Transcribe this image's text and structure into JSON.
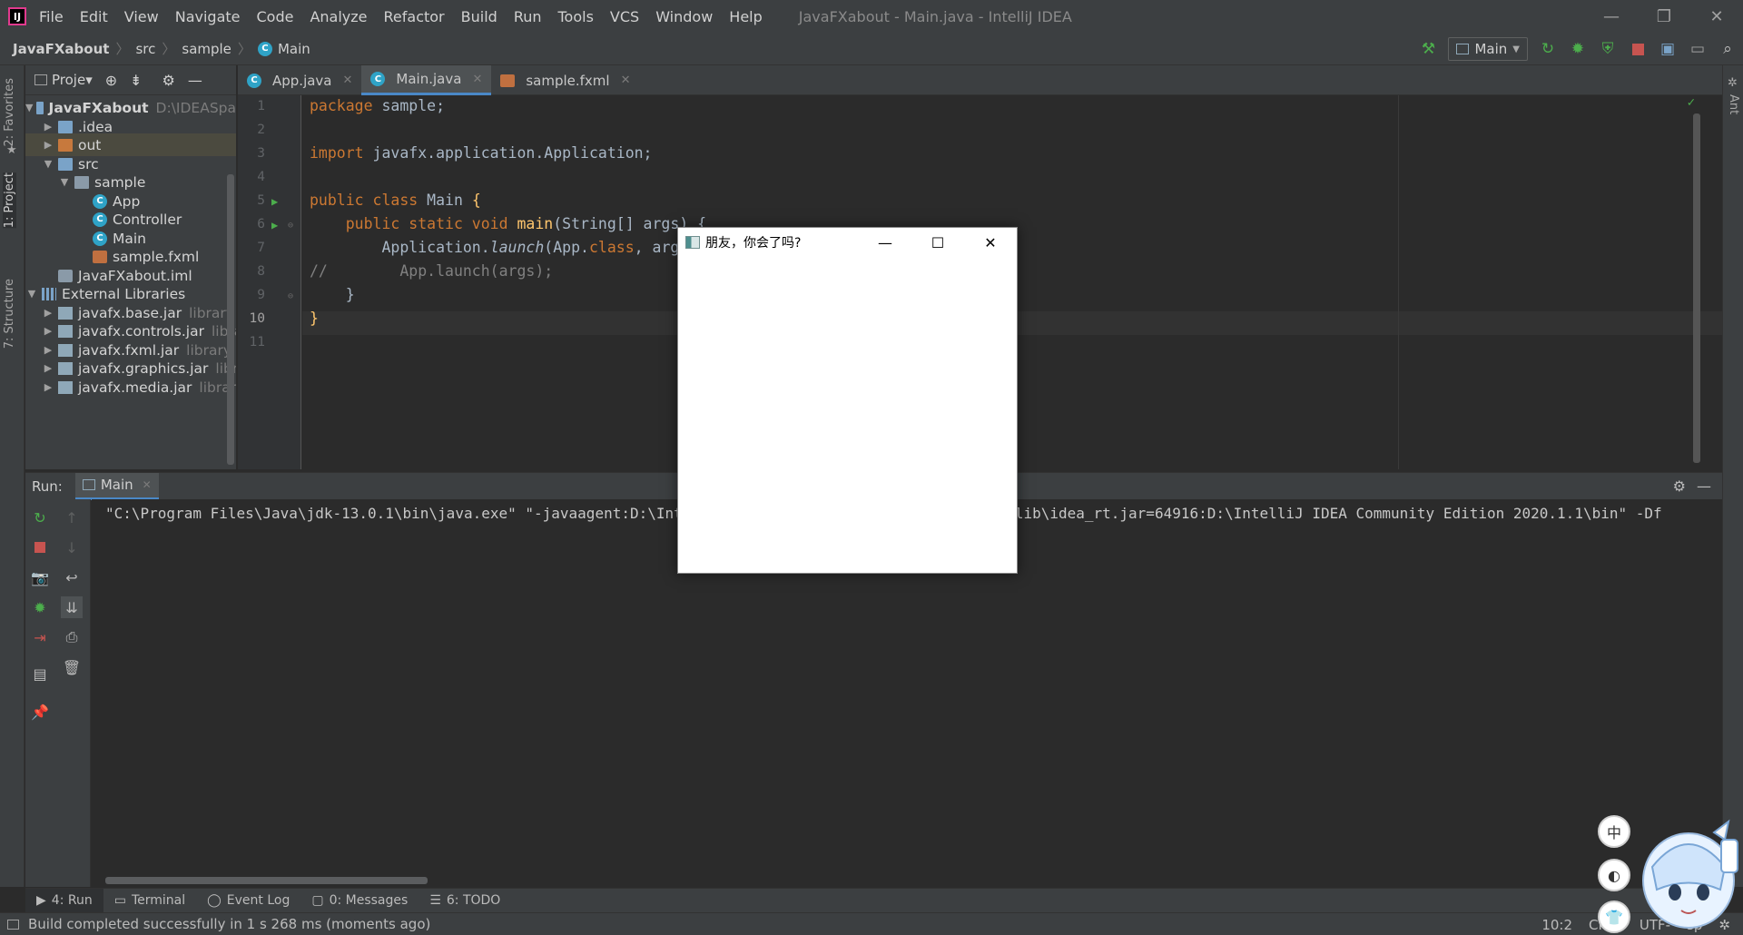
{
  "app": {
    "logo_text": "IJ",
    "menu": [
      "File",
      "Edit",
      "View",
      "Navigate",
      "Code",
      "Analyze",
      "Refactor",
      "Build",
      "Run",
      "Tools",
      "VCS",
      "Window",
      "Help"
    ],
    "window_title": "JavaFXabout - Main.java - IntelliJ IDEA",
    "window_controls": {
      "minimize": "—",
      "restore": "❐",
      "close": "✕"
    }
  },
  "navbar": {
    "breadcrumbs": [
      "JavaFXabout",
      "src",
      "sample",
      "Main"
    ],
    "run_config": "Main"
  },
  "left_stripe": {
    "favorites": "2: Favorites",
    "project": "1: Project",
    "structure": "7: Structure"
  },
  "right_stripe": {
    "ant": "Ant"
  },
  "project_panel": {
    "title": "Proje▾",
    "tree": [
      {
        "label": "JavaFXabout",
        "hint": "D:\\IDEASpa",
        "type": "module",
        "arrow": "▼"
      },
      {
        "label": ".idea",
        "type": "folder",
        "arrow": "▶"
      },
      {
        "label": "out",
        "type": "folder-out",
        "arrow": "▶"
      },
      {
        "label": "src",
        "type": "folder",
        "arrow": "▼"
      },
      {
        "label": "sample",
        "type": "package",
        "arrow": "▼"
      },
      {
        "label": "App",
        "type": "class"
      },
      {
        "label": "Controller",
        "type": "class"
      },
      {
        "label": "Main",
        "type": "class"
      },
      {
        "label": "sample.fxml",
        "type": "fxml"
      },
      {
        "label": "JavaFXabout.iml",
        "type": "iml"
      },
      {
        "label": "External Libraries",
        "type": "libs",
        "arrow": "▼"
      },
      {
        "label": "javafx.base.jar",
        "hint": "library r",
        "type": "jar",
        "arrow": "▶"
      },
      {
        "label": "javafx.controls.jar",
        "hint": "libra",
        "type": "jar",
        "arrow": "▶"
      },
      {
        "label": "javafx.fxml.jar",
        "hint": "library r",
        "type": "jar",
        "arrow": "▶"
      },
      {
        "label": "javafx.graphics.jar",
        "hint": "libr",
        "type": "jar",
        "arrow": "▶"
      },
      {
        "label": "javafx.media.jar",
        "hint": "library",
        "type": "jar",
        "arrow": "▶"
      }
    ]
  },
  "editor": {
    "tabs": [
      {
        "label": "App.java",
        "active": false
      },
      {
        "label": "Main.java",
        "active": true
      },
      {
        "label": "sample.fxml",
        "active": false
      }
    ],
    "line_numbers": [
      "1",
      "2",
      "3",
      "4",
      "5",
      "6",
      "7",
      "8",
      "9",
      "10",
      "11"
    ],
    "code": {
      "l1_kw": "package",
      "l1_rest": " sample;",
      "l3_kw": "import",
      "l3_rest": " javafx.application.Application;",
      "l5_kw": "public class",
      "l5_name": " Main ",
      "l5_brace": "{",
      "l6_kw": "    public static void",
      "l6_fn": " main",
      "l6_rest": "(String[] args) {",
      "l7_pre": "        Application.",
      "l7_it": "launch",
      "l7_mid": "(App.",
      "l7_kw": "class",
      "l7_rest": ", arg",
      "l8_cm": "//        App.launch(args);",
      "l9": "    }",
      "l10": "}"
    }
  },
  "run_panel": {
    "label": "Run:",
    "tab": "Main",
    "console_line": "\"C:\\Program Files\\Java\\jdk-13.0.1\\bin\\java.exe\" \"-javaagent:D:\\IntelliJ IDEA Community Edition 2020.1.1\\lib\\idea_rt.jar=64916:D:\\IntelliJ IDEA Community Edition 2020.1.1\\bin\" -Df"
  },
  "bottom_tabs": [
    {
      "label": "4: Run",
      "icon": "run-icon"
    },
    {
      "label": "Terminal",
      "icon": "terminal-icon"
    },
    {
      "label": "Event Log",
      "icon": "event-log-icon"
    },
    {
      "label": "0: Messages",
      "icon": "messages-icon"
    },
    {
      "label": "6: TODO",
      "icon": "todo-icon"
    }
  ],
  "status": {
    "message": "Build completed successfully in 1 s 268 ms (moments ago)",
    "position": "10:2",
    "line_sep": "CRLF",
    "encoding": "UTF-",
    "indent": "sp"
  },
  "fx_window": {
    "title": "朋友，你会了吗?",
    "controls": {
      "minimize": "—",
      "maximize": "☐",
      "close": "✕"
    }
  },
  "floating": {
    "btn1": "中",
    "btn2": "◐",
    "btn3": "👕"
  },
  "colors": {
    "accent": "#4a88c7",
    "run_green": "#4cae4c",
    "stop_red": "#c75450",
    "keyword": "#cc7832",
    "function": "#ffc66d"
  }
}
